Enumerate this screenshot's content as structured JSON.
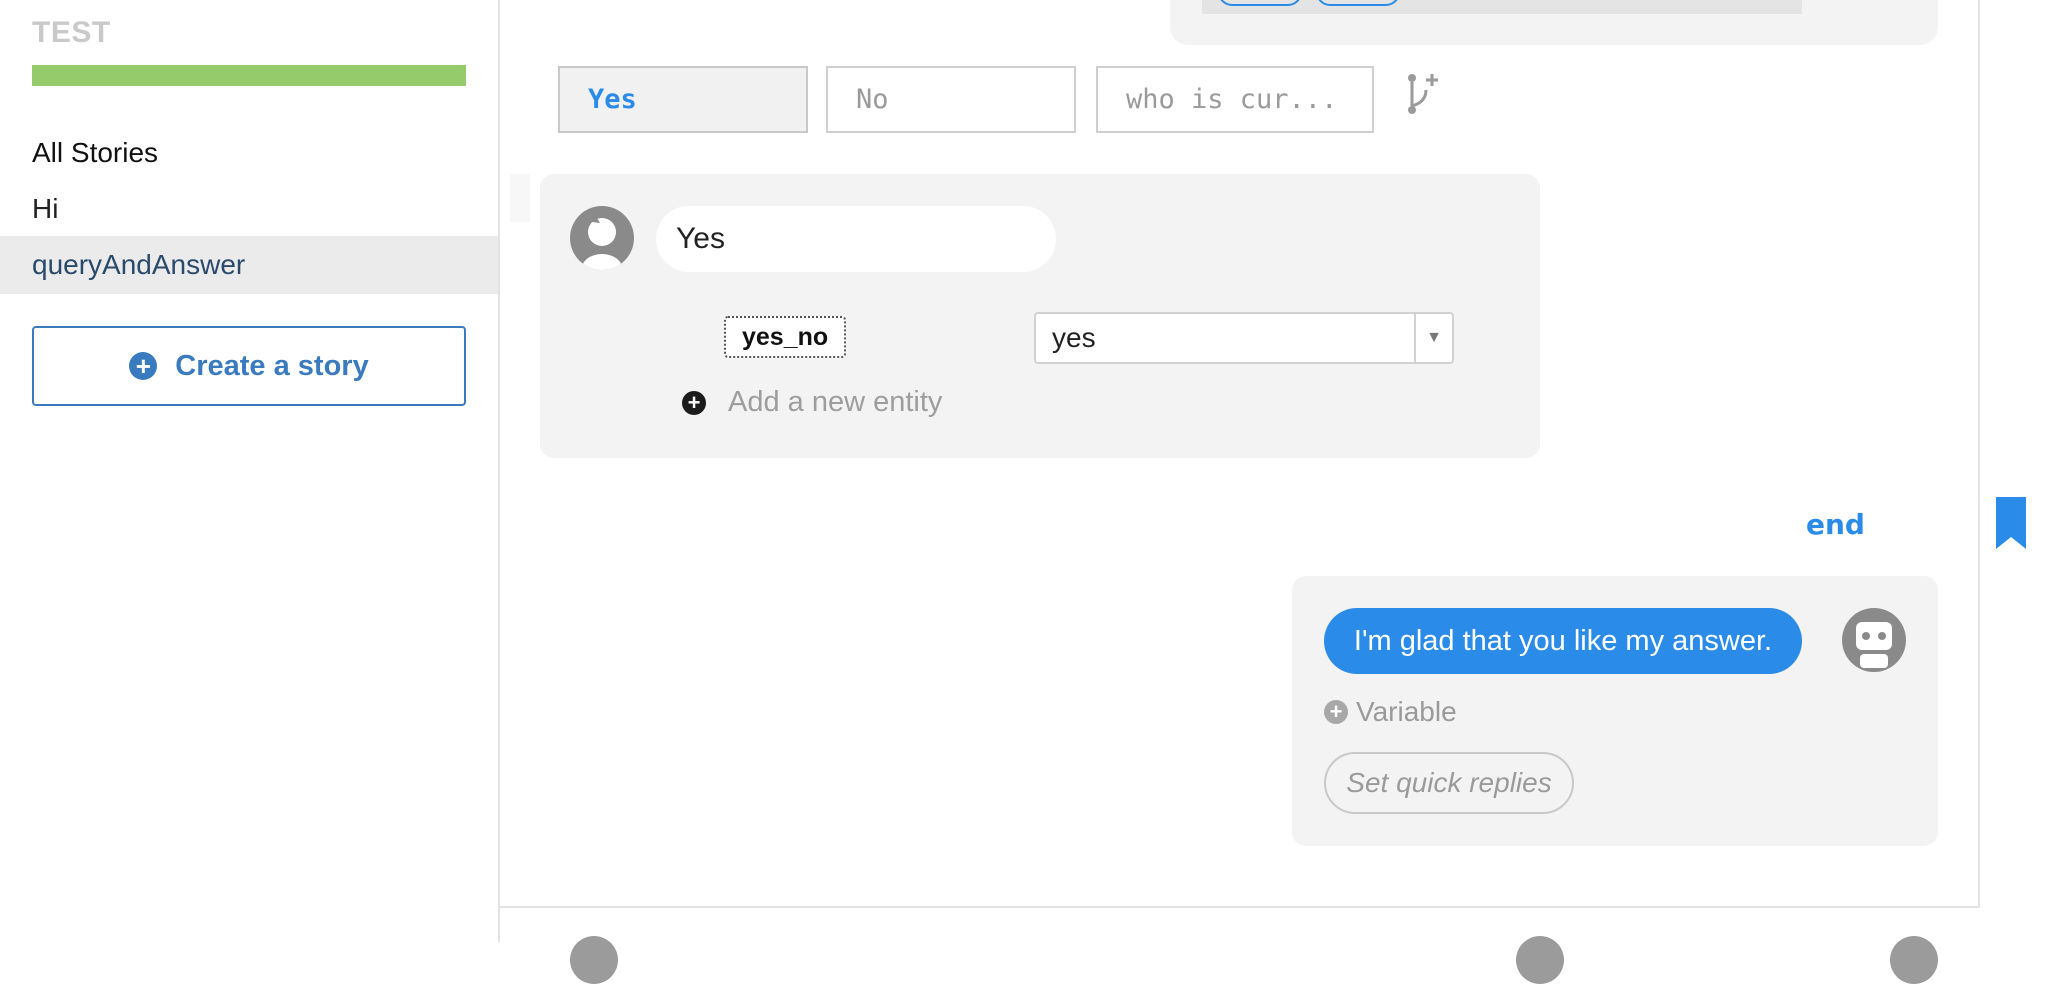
{
  "sidebar": {
    "app_title": "TEST",
    "progress_fraction": 1.0,
    "progress_color": "#96cb6c",
    "items": [
      {
        "label": "All Stories",
        "type": "header"
      },
      {
        "label": "Hi",
        "type": "story"
      },
      {
        "label": "queryAndAnswer",
        "type": "story",
        "active": true
      }
    ],
    "create_button": {
      "icon": "plus-circle-icon",
      "label": "Create a story"
    }
  },
  "quick_replies": {
    "chips": [
      {
        "label": "Yes",
        "selected": true
      },
      {
        "label": "No",
        "selected": false
      },
      {
        "label": "who is cur...",
        "selected": false
      }
    ],
    "branch_icon": "branch-add-icon"
  },
  "user_message": {
    "avatar_icon": "user-avatar-icon",
    "text": "Yes",
    "entities": [
      {
        "name": "yes_no",
        "value": "yes"
      }
    ],
    "add_entity_label": "Add a new entity"
  },
  "end_label": "end",
  "bookmark_icon": "bookmark-icon",
  "bot_message": {
    "avatar_icon": "bot-avatar-icon",
    "text": "I'm glad that you like my answer.",
    "variable_label": "Variable",
    "quick_replies_label": "Set quick replies"
  },
  "colors": {
    "accent": "#2b8be8",
    "brand_blue": "#3a7bbf",
    "progress_green": "#96cb6c",
    "card_bg": "#f3f3f3"
  }
}
